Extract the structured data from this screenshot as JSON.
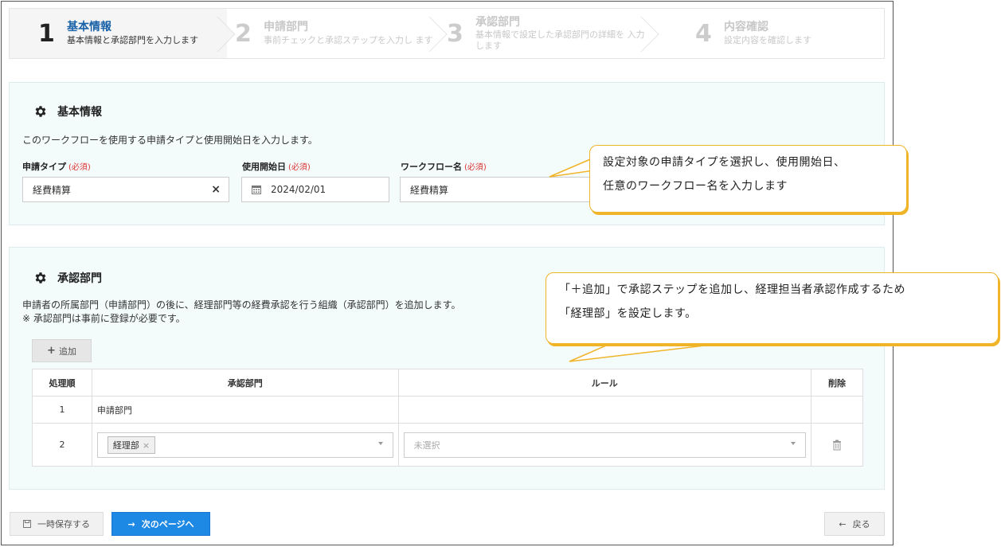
{
  "stepper": [
    {
      "num": "1",
      "title": "基本情報",
      "sub": "基本情報と承認部門を入力します"
    },
    {
      "num": "2",
      "title": "申請部門",
      "sub": "事前チェックと承認ステップを入力し ます"
    },
    {
      "num": "3",
      "title": "承認部門",
      "sub": "基本情報で設定した承認部門の詳細を 入力します"
    },
    {
      "num": "4",
      "title": "内容確認",
      "sub": "設定内容を確認します"
    }
  ],
  "basic": {
    "title": "基本情報",
    "description": "このワークフローを使用する申請タイプと使用開始日を入力します。",
    "required_mark": "(必須)",
    "type_label": "申請タイプ",
    "type_value": "経費精算",
    "clear_mark": "×",
    "date_label": "使用開始日",
    "date_value": "2024/02/01",
    "name_label": "ワークフロー名",
    "name_value": "経費精算"
  },
  "approval": {
    "title": "承認部門",
    "description1": "申請者の所属部門（申請部門）の後に、経理部門等の経費承認を行う組織（承認部門）を追加します。",
    "description2": "※ 承認部門は事前に登録が必要です。",
    "add_icon": "+",
    "add_label": "追加",
    "columns": [
      "処理順",
      "承認部門",
      "ルール",
      "削除"
    ],
    "rows": [
      {
        "order": "1",
        "dept": "申請部門"
      },
      {
        "order": "2",
        "dept_tag": "経理部",
        "tag_remove": "×",
        "rule_placeholder": "未選択"
      }
    ]
  },
  "footer": {
    "save_label": "一時保存する",
    "next_label": "次のページへ",
    "next_icon": "→",
    "back_label": "戻る",
    "back_icon": "←"
  },
  "callouts": {
    "c1_line1": "設定対象の申請タイプを選択し、使用開始日、",
    "c1_line2": "任意のワークフロー名を入力します",
    "c2_line1": "「＋追加」で承認ステップを追加し、経理担当者承認作成するため",
    "c2_line2": "「経理部」を設定します。"
  },
  "colors": {
    "accent": "#1e88e5",
    "callout_border": "#f0b429",
    "required": "#dd3333",
    "panel_bg": "#f3fbfb"
  }
}
